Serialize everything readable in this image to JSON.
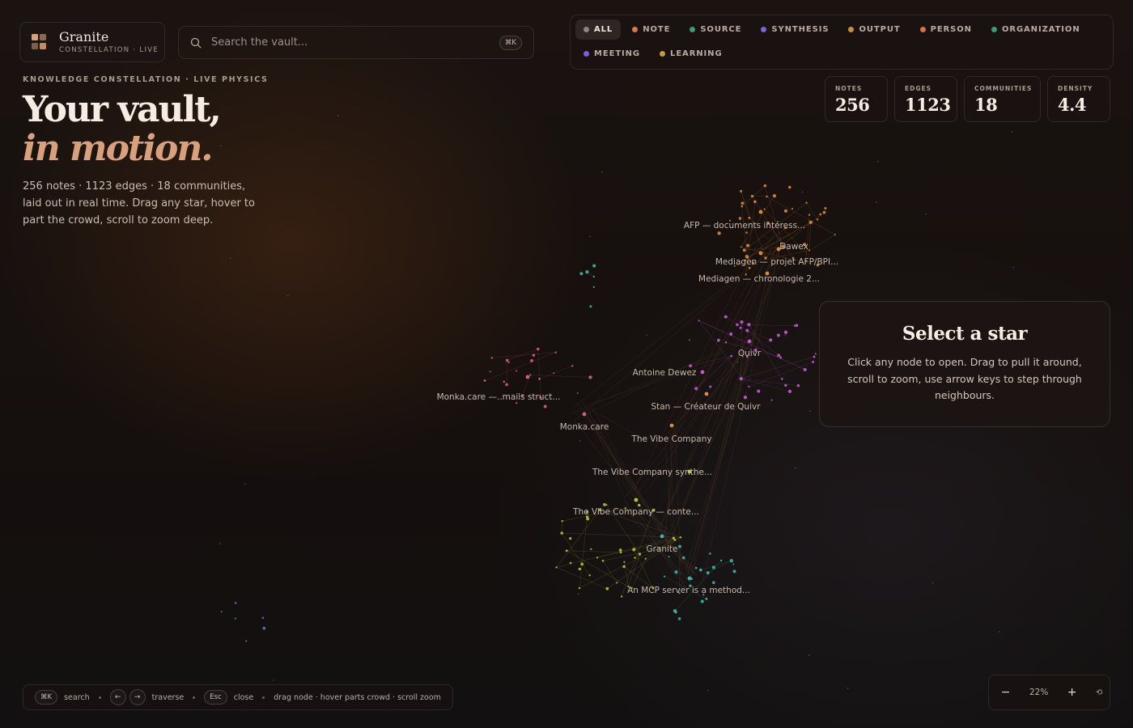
{
  "brand": {
    "title": "Granite",
    "subtitle": "CONSTELLATION · LIVE",
    "mark_colors": [
      "#d6a179",
      "#8b6a52",
      "#7a5f4b",
      "#c48b63"
    ]
  },
  "search": {
    "placeholder": "Search the vault...",
    "shortcut": "⌘K"
  },
  "filters": [
    {
      "label": "ALL",
      "color": "#8f857d",
      "active": true
    },
    {
      "label": "NOTE",
      "color": "#d9784a",
      "active": false
    },
    {
      "label": "SOURCE",
      "color": "#3e9a7b",
      "active": false
    },
    {
      "label": "SYNTHESIS",
      "color": "#7b62d8",
      "active": false
    },
    {
      "label": "OUTPUT",
      "color": "#c9903d",
      "active": false
    },
    {
      "label": "PERSON",
      "color": "#d86f4e",
      "active": false
    },
    {
      "label": "ORGANIZATION",
      "color": "#3d9a76",
      "active": false
    },
    {
      "label": "MEETING",
      "color": "#7a5fe0",
      "active": false
    },
    {
      "label": "LEARNING",
      "color": "#c99a3b",
      "active": false
    }
  ],
  "hero": {
    "eyebrow": "KNOWLEDGE CONSTELLATION · LIVE PHYSICS",
    "line1": "Your vault,",
    "line2": "in motion.",
    "description": "256 notes · 1123 edges · 18 communities, laid out in real time. Drag any star, hover to part the crowd, scroll to zoom deep."
  },
  "stats": [
    {
      "label": "NOTES",
      "value": "256"
    },
    {
      "label": "EDGES",
      "value": "1123"
    },
    {
      "label": "COMMUNITIES",
      "value": "18"
    },
    {
      "label": "DENSITY",
      "value": "4.4"
    }
  ],
  "info_panel": {
    "title": "Select a star",
    "body": "Click any node to open. Drag to pull it around, scroll to zoom, use arrow keys to step through neighbours."
  },
  "hints": {
    "search_key": "⌘K",
    "search_label": "search",
    "prev_key": "←",
    "next_key": "→",
    "traverse_label": "traverse",
    "close_key": "Esc",
    "close_label": "close",
    "extra": "drag node · hover parts crowd · scroll zoom"
  },
  "zoom": {
    "minus": "−",
    "value": "22%",
    "plus": "+",
    "reset_icon": "reset-icon"
  },
  "graph": {
    "labels": [
      "AFP — documents intéress...",
      "Dawex",
      "Mediagen — projet AFP/BPI...",
      "Mediagen — chronologie 2...",
      "Quivr",
      "Antoine Dewez",
      "Monka.care —..mails struct...",
      "Stan — Créateur de Quivr",
      "Monka.care",
      "The Vibe Company",
      "The Vibe Company synthe...",
      "The Vibe Company — conte...",
      "Granite",
      "An MCP server is a method..."
    ],
    "community_colors": [
      "#d98a3e",
      "#c45ad0",
      "#d4607a",
      "#b8c03a",
      "#3fb3a4",
      "#5a74c8"
    ]
  }
}
